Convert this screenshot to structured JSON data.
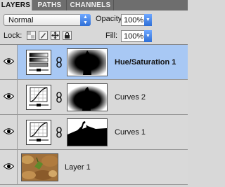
{
  "tabs": [
    {
      "label": "LAYERS",
      "active": true
    },
    {
      "label": "PATHS",
      "active": false
    },
    {
      "label": "CHANNELS",
      "active": false
    }
  ],
  "blend_mode": {
    "value": "Normal"
  },
  "opacity": {
    "label": "Opacity:",
    "value": "100%"
  },
  "lock": {
    "label": "Lock:"
  },
  "fill": {
    "label": "Fill:",
    "value": "100%"
  },
  "layers": [
    {
      "name": "Hue/Saturation 1",
      "type": "adjustment-hue-saturation",
      "visible": true,
      "selected": true,
      "has_mask": true
    },
    {
      "name": "Curves 2",
      "type": "adjustment-curves",
      "visible": true,
      "selected": false,
      "has_mask": true
    },
    {
      "name": "Curves 1",
      "type": "adjustment-curves",
      "visible": true,
      "selected": false,
      "has_mask": true
    },
    {
      "name": "Layer 1",
      "type": "pixel",
      "visible": true,
      "selected": false,
      "has_mask": false
    }
  ],
  "colors": {
    "selection": "#a8c8f4",
    "accent": "#2f6fd6",
    "panel": "#d8d8d8"
  }
}
